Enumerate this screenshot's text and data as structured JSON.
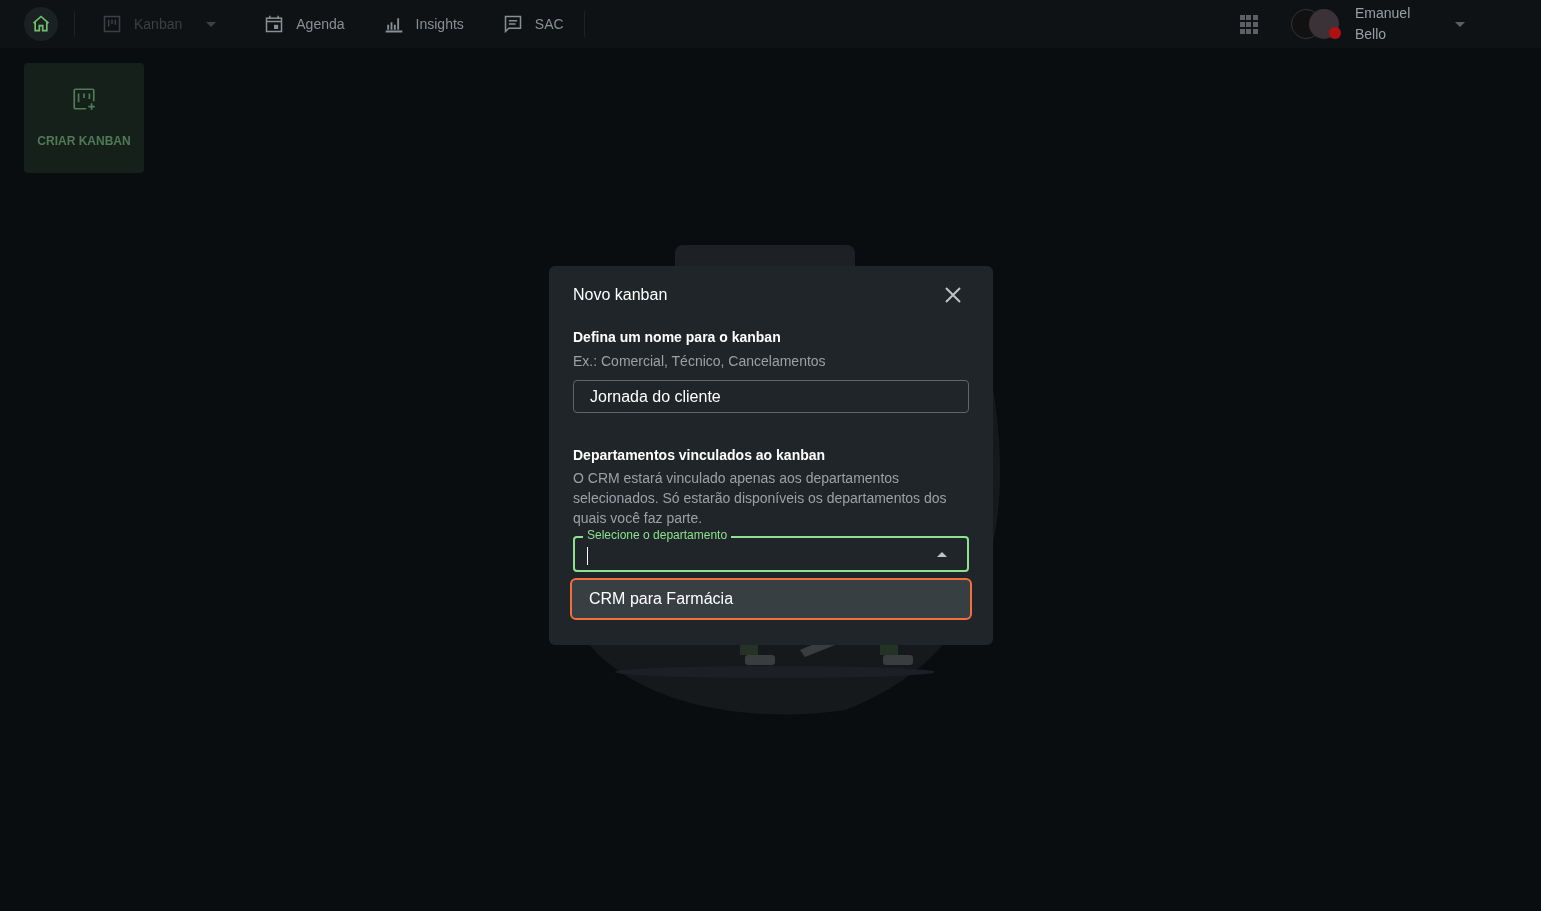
{
  "nav": {
    "items": [
      {
        "kind": "home",
        "selected": true,
        "disabled": false,
        "dropdown": false
      },
      {
        "kind": "kanban",
        "label": "Kanban",
        "selected": false,
        "disabled": true,
        "dropdown": true
      },
      {
        "kind": "calendar",
        "label": "Agenda",
        "selected": false,
        "disabled": false,
        "dropdown": false
      },
      {
        "kind": "chart",
        "label": "Insights",
        "selected": false,
        "disabled": false,
        "dropdown": false
      },
      {
        "kind": "chat",
        "label": "SAC",
        "selected": false,
        "disabled": false,
        "dropdown": false
      }
    ],
    "user": {
      "first_name": "Emanuel",
      "last_name": "Bello",
      "online": false
    }
  },
  "create_card": {
    "label": "CRIAR KANBAN"
  },
  "dialog": {
    "title": "Novo kanban",
    "name_section": {
      "heading": "Defina um nome para o kanban",
      "hint": "Ex.: Comercial, Técnico, Cancelamentos",
      "value": "Jornada do cliente"
    },
    "departments_section": {
      "heading": "Departamentos vinculados ao kanban",
      "description": "O CRM estará vinculado apenas aos departamentos selecionados. Só estarão disponíveis os departamentos dos quais você faz parte.",
      "select_label": "Selecione o departamento",
      "expanded": true,
      "options": [
        {
          "label": "CRM para Farmácia",
          "highlighted": true
        }
      ]
    }
  }
}
